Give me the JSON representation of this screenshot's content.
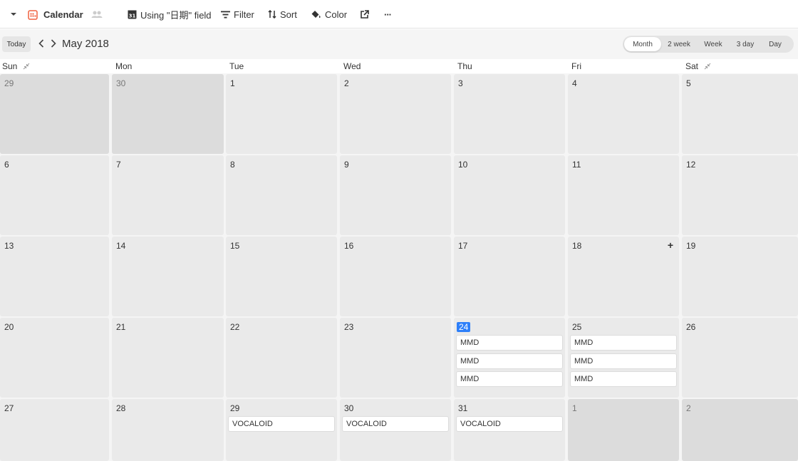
{
  "toolbar": {
    "view_name": "Calendar",
    "using_field_label": "Using \"日期\" field",
    "filter_label": "Filter",
    "sort_label": "Sort",
    "color_label": "Color",
    "more_label": "···",
    "icons": [
      "chevron-down-icon",
      "calendar-icon",
      "people-icon",
      "date-field-icon",
      "filter-icon",
      "sort-icon",
      "paint-bucket-icon",
      "share-icon",
      "more-icon"
    ]
  },
  "nav": {
    "today_label": "Today",
    "month_title": "May 2018",
    "views": [
      "Month",
      "2 week",
      "Week",
      "3 day",
      "Day"
    ],
    "active_view": "Month"
  },
  "day_headers": [
    "Sun",
    "Mon",
    "Tue",
    "Wed",
    "Thu",
    "Fri",
    "Sat"
  ],
  "weeks": [
    [
      {
        "d": "29",
        "out": true
      },
      {
        "d": "30",
        "out": true
      },
      {
        "d": "1"
      },
      {
        "d": "2"
      },
      {
        "d": "3"
      },
      {
        "d": "4"
      },
      {
        "d": "5"
      }
    ],
    [
      {
        "d": "6"
      },
      {
        "d": "7"
      },
      {
        "d": "8"
      },
      {
        "d": "9"
      },
      {
        "d": "10"
      },
      {
        "d": "11"
      },
      {
        "d": "12"
      }
    ],
    [
      {
        "d": "13"
      },
      {
        "d": "14"
      },
      {
        "d": "15"
      },
      {
        "d": "16"
      },
      {
        "d": "17"
      },
      {
        "d": "18",
        "plus": "+"
      },
      {
        "d": "19"
      }
    ],
    [
      {
        "d": "20"
      },
      {
        "d": "21"
      },
      {
        "d": "22"
      },
      {
        "d": "23"
      },
      {
        "d": "24",
        "today": true,
        "events": [
          "MMD",
          "MMD",
          "MMD"
        ]
      },
      {
        "d": "25",
        "events": [
          "MMD",
          "MMD",
          "MMD"
        ]
      },
      {
        "d": "26"
      }
    ],
    [
      {
        "d": "27"
      },
      {
        "d": "28"
      },
      {
        "d": "29",
        "events": [
          "VOCALOID"
        ]
      },
      {
        "d": "30",
        "events": [
          "VOCALOID"
        ]
      },
      {
        "d": "31",
        "events": [
          "VOCALOID"
        ]
      },
      {
        "d": "1",
        "out": true
      },
      {
        "d": "2",
        "out": true
      }
    ]
  ],
  "colors": {
    "today": "#2d7ff9",
    "cell": "#eaeaea",
    "cell_out": "#dcdcdc",
    "calendar_icon": "#f0613f"
  }
}
